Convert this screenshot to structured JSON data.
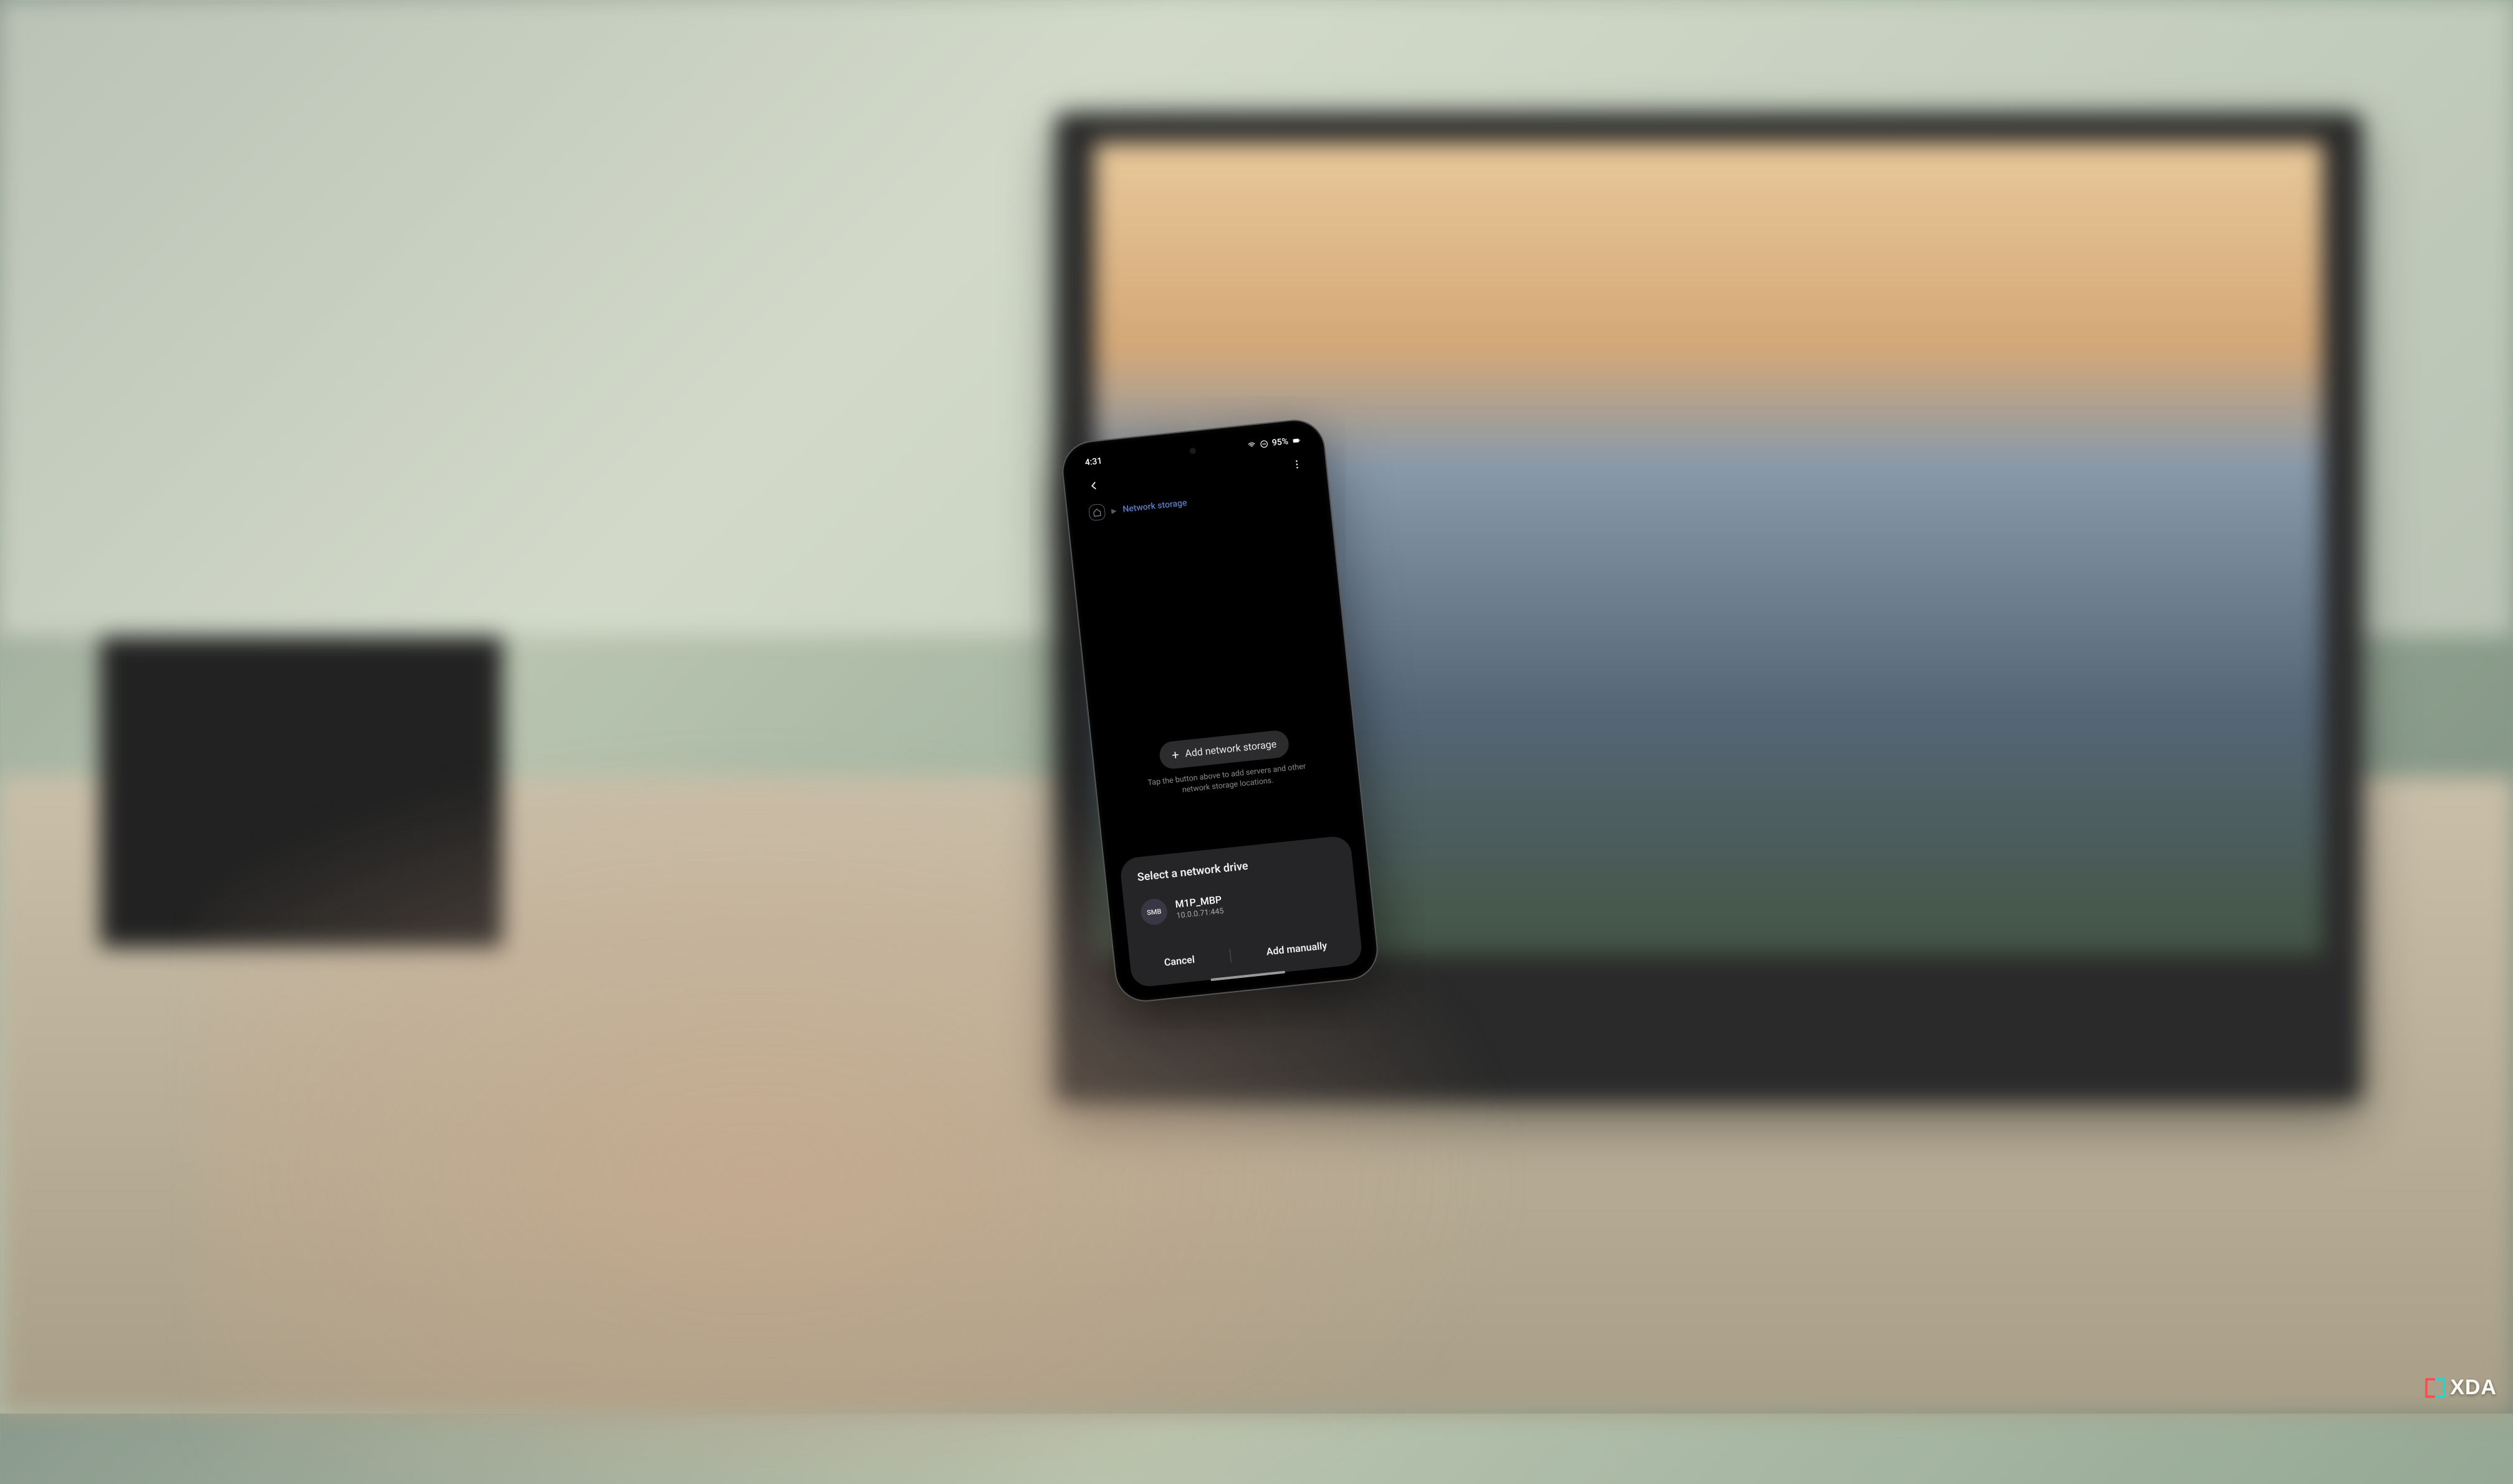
{
  "status_bar": {
    "time": "4:31",
    "battery_text": "95%",
    "icons": [
      "wifi",
      "dnd",
      "battery"
    ]
  },
  "breadcrumb": {
    "current": "Network storage"
  },
  "add_button": {
    "label": "Add network storage"
  },
  "hint": "Tap the button above to add servers and other network storage locations.",
  "sheet": {
    "title": "Select a network drive",
    "drive": {
      "badge": "SMB",
      "name": "M1P_MBP",
      "address": "10.0.0.71:445"
    },
    "actions": {
      "cancel": "Cancel",
      "add_manually": "Add manually"
    }
  },
  "watermark": "XDA"
}
